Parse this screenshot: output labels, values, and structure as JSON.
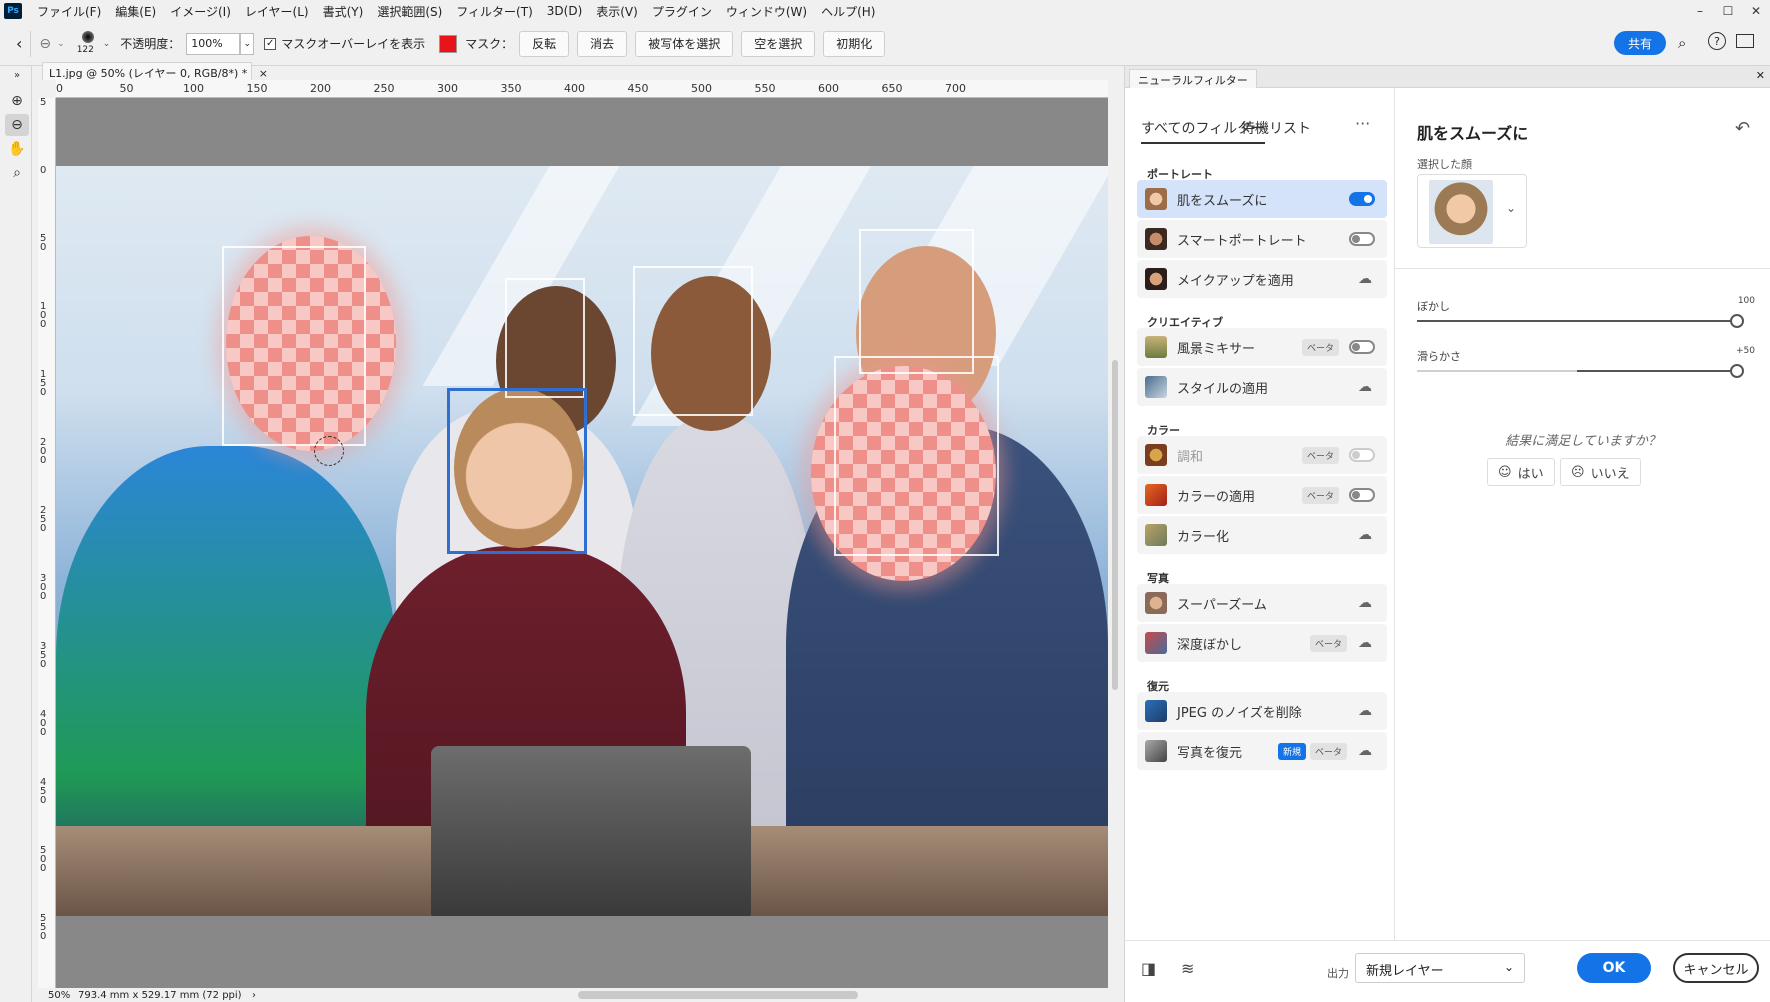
{
  "menubar": {
    "logo": "Ps",
    "items": [
      "ファイル(F)",
      "編集(E)",
      "イメージ(I)",
      "レイヤー(L)",
      "書式(Y)",
      "選択範囲(S)",
      "フィルター(T)",
      "3D(D)",
      "表示(V)",
      "プラグイン",
      "ウィンドウ(W)",
      "ヘルプ(H)"
    ],
    "win_buttons": [
      "–",
      "☐",
      "✕"
    ]
  },
  "options": {
    "brush_size": "122",
    "opacity_label": "不透明度：",
    "opacity_value": "100%",
    "mask_overlay_label": "マスクオーバーレイを表示",
    "mask_label": "マスク：",
    "buttons": [
      "反転",
      "消去",
      "被写体を選択",
      "空を選択",
      "初期化"
    ],
    "share": "共有",
    "overlay_color": "#e8141a"
  },
  "document": {
    "tab_title": "L1.jpg @ 50% (レイヤー 0, RGB/8*) *",
    "ruler_top": [
      "0",
      "50",
      "100",
      "150",
      "200",
      "250",
      "300",
      "350",
      "400",
      "450",
      "500",
      "550",
      "600",
      "650",
      "700"
    ],
    "ruler_left": [
      "5",
      "0",
      "5 0",
      "1 0 0",
      "1 5 0",
      "2 0 0",
      "2 5 0",
      "3 0 0",
      "3 5 0",
      "4 0 0",
      "4 5 0",
      "5 0 0",
      "5 5 0"
    ],
    "status_zoom": "50%",
    "status_size": "793.4 mm x 529.17 mm (72 ppi)"
  },
  "neural_filters": {
    "panel_tab": "ニューラルフィルター",
    "tabs": [
      "すべてのフィルター",
      "待機リスト"
    ],
    "more": "···",
    "categories": {
      "portrait": "ポートレート",
      "creative": "クリエイティブ",
      "color": "カラー",
      "photo": "写真",
      "restore": "復元"
    },
    "filters": [
      {
        "name": "肌をスムーズに"
      },
      {
        "name": "スマートポートレート"
      },
      {
        "name": "メイクアップを適用"
      },
      {
        "name": "風景ミキサー",
        "badge": "ベータ"
      },
      {
        "name": "スタイルの適用"
      },
      {
        "name": "調和",
        "badge": "ベータ"
      },
      {
        "name": "カラーの適用",
        "badge": "ベータ"
      },
      {
        "name": "カラー化"
      },
      {
        "name": "スーパーズーム"
      },
      {
        "name": "深度ぼかし",
        "badge": "ベータ"
      },
      {
        "name": "JPEG のノイズを削除"
      },
      {
        "name": "写真を復元",
        "badge": "ベータ",
        "new": "新規"
      }
    ],
    "detail": {
      "title": "肌をスムーズに",
      "selected_face_label": "選択した顔",
      "blur_label": "ぼかし",
      "blur_value": "100",
      "blur_level": 1.0,
      "smooth_label": "滑らかさ",
      "smooth_value": "+50",
      "smooth_level": 1.0,
      "satisfied": "結果に満足していますか？",
      "yes": "はい",
      "no": "いいえ"
    },
    "footer": {
      "output_label": "出力",
      "output_value": "新規レイヤー",
      "ok": "OK",
      "cancel": "キャンセル"
    }
  }
}
